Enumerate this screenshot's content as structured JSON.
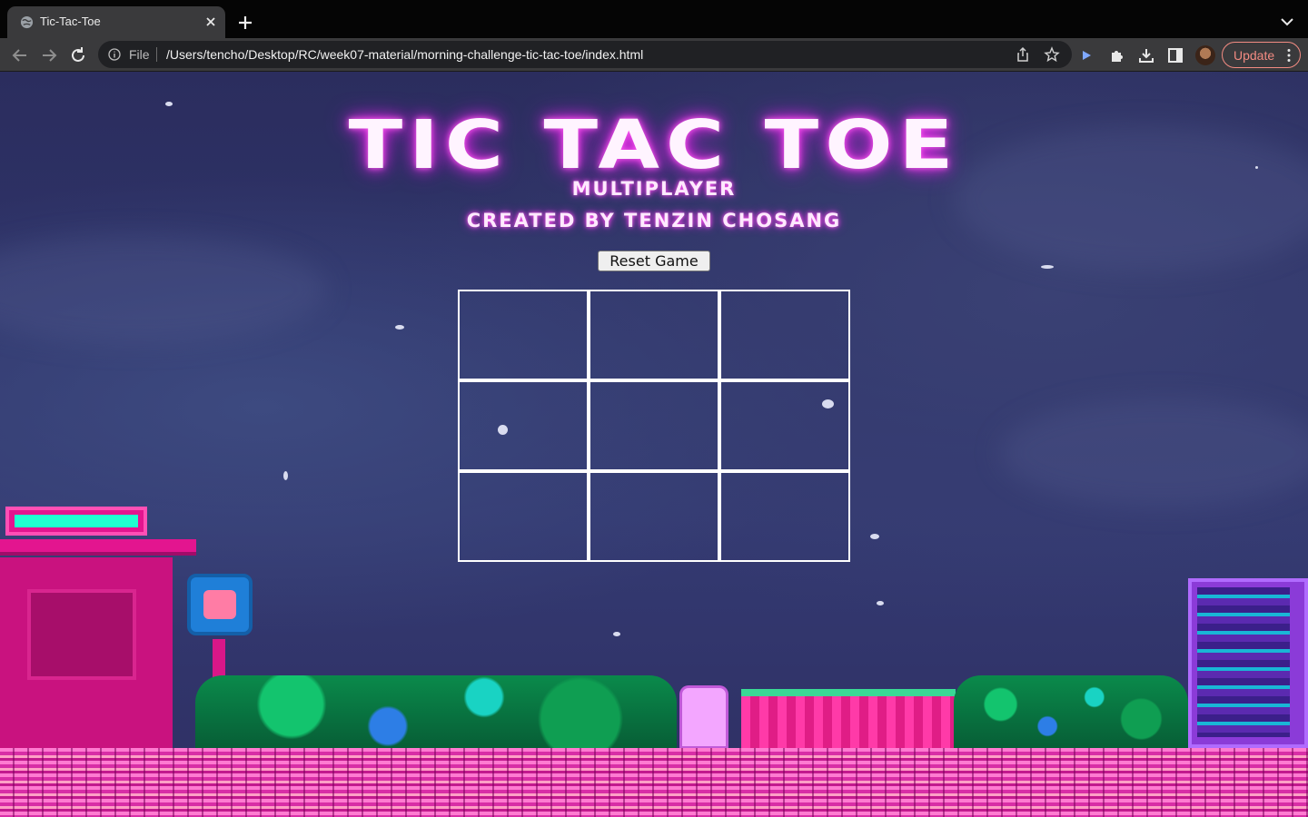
{
  "browser": {
    "tab_title": "Tic-Tac-Toe",
    "scheme_label": "File",
    "url": "/Users/tencho/Desktop/RC/week07-material/morning-challenge-tic-tac-toe/index.html",
    "update_label": "Update"
  },
  "game": {
    "title": "TIC TAC TOE",
    "subtitle": "MULTIPLAYER",
    "credit": "CREATED BY TENZIN CHOSANG",
    "reset_label": "Reset Game",
    "board": [
      "",
      "",
      "",
      "",
      "",
      "",
      "",
      "",
      ""
    ]
  },
  "colors": {
    "title_glow": "#e12ee0",
    "sky": "#2f346a",
    "update_accent": "#f28b82"
  },
  "icons": [
    "globe-icon",
    "close-icon",
    "plus-icon",
    "chevron-down-icon",
    "back-icon",
    "forward-icon",
    "reload-icon",
    "info-icon",
    "share-icon",
    "star-icon",
    "extension-play-icon",
    "puzzle-icon",
    "download-icon",
    "sidebar-icon",
    "more-vert-icon"
  ]
}
